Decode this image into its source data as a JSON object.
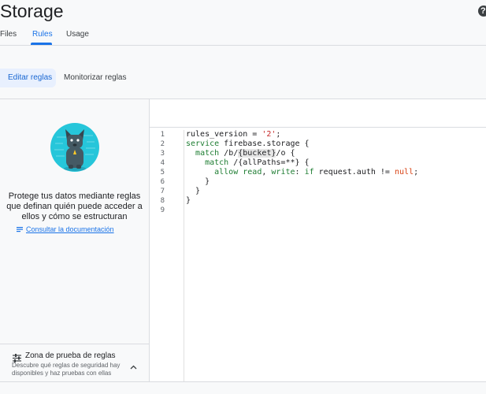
{
  "header": {
    "title": "Storage",
    "help_glyph": "?"
  },
  "tabs": [
    {
      "label": "Files"
    },
    {
      "label": "Rules"
    },
    {
      "label": "Usage"
    }
  ],
  "subtabs": [
    {
      "label": "Editar reglas"
    },
    {
      "label": "Monitorizar reglas"
    }
  ],
  "left_panel": {
    "description": "Protege tus datos mediante reglas que definan quién puede acceder a ellos y cómo se estructuran",
    "doc_link": "Consultar la documentación"
  },
  "playground": {
    "title": "Zona de prueba de reglas",
    "subtitle": "Descubre qué reglas de seguridad hay disponibles y haz pruebas con ellas"
  },
  "editor": {
    "line_numbers": [
      "1",
      "2",
      "3",
      "4",
      "5",
      "6",
      "7",
      "8",
      "9"
    ],
    "lines": [
      [
        {
          "t": "rules_version = "
        },
        {
          "t": "'2'",
          "c": "str"
        },
        {
          "t": ";"
        }
      ],
      [
        {
          "t": "service",
          "c": "kw"
        },
        {
          "t": " firebase.storage {"
        }
      ],
      [
        {
          "t": "  "
        },
        {
          "t": "match",
          "c": "kw"
        },
        {
          "t": " /b/"
        },
        {
          "t": "{bucket}",
          "c": "hl"
        },
        {
          "t": "/o {"
        }
      ],
      [
        {
          "t": "    "
        },
        {
          "t": "match",
          "c": "kw"
        },
        {
          "t": " /{allPaths=**} {"
        }
      ],
      [
        {
          "t": "      "
        },
        {
          "t": "allow",
          "c": "kw"
        },
        {
          "t": " "
        },
        {
          "t": "read",
          "c": "kw"
        },
        {
          "t": ", "
        },
        {
          "t": "write",
          "c": "kw"
        },
        {
          "t": ": "
        },
        {
          "t": "if",
          "c": "kw"
        },
        {
          "t": " request.auth != "
        },
        {
          "t": "null",
          "c": "nul"
        },
        {
          "t": ";"
        }
      ],
      [
        {
          "t": "    }"
        }
      ],
      [
        {
          "t": "  }"
        }
      ],
      [
        {
          "t": "}"
        }
      ],
      [
        {
          "t": ""
        }
      ]
    ]
  },
  "colors": {
    "accent": "#1a73e8",
    "keyword": "#1e7d32",
    "string": "#c62828",
    "illustration_bg": "#26c6da"
  }
}
